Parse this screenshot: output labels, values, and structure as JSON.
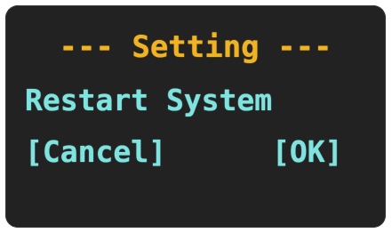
{
  "dialog": {
    "title": "--- Setting ---",
    "message": "Restart System",
    "cancel_label": "[Cancel]",
    "ok_label": "[OK]"
  },
  "colors": {
    "background": "#222222",
    "title": "#f0b323",
    "text": "#7fe3e0"
  }
}
